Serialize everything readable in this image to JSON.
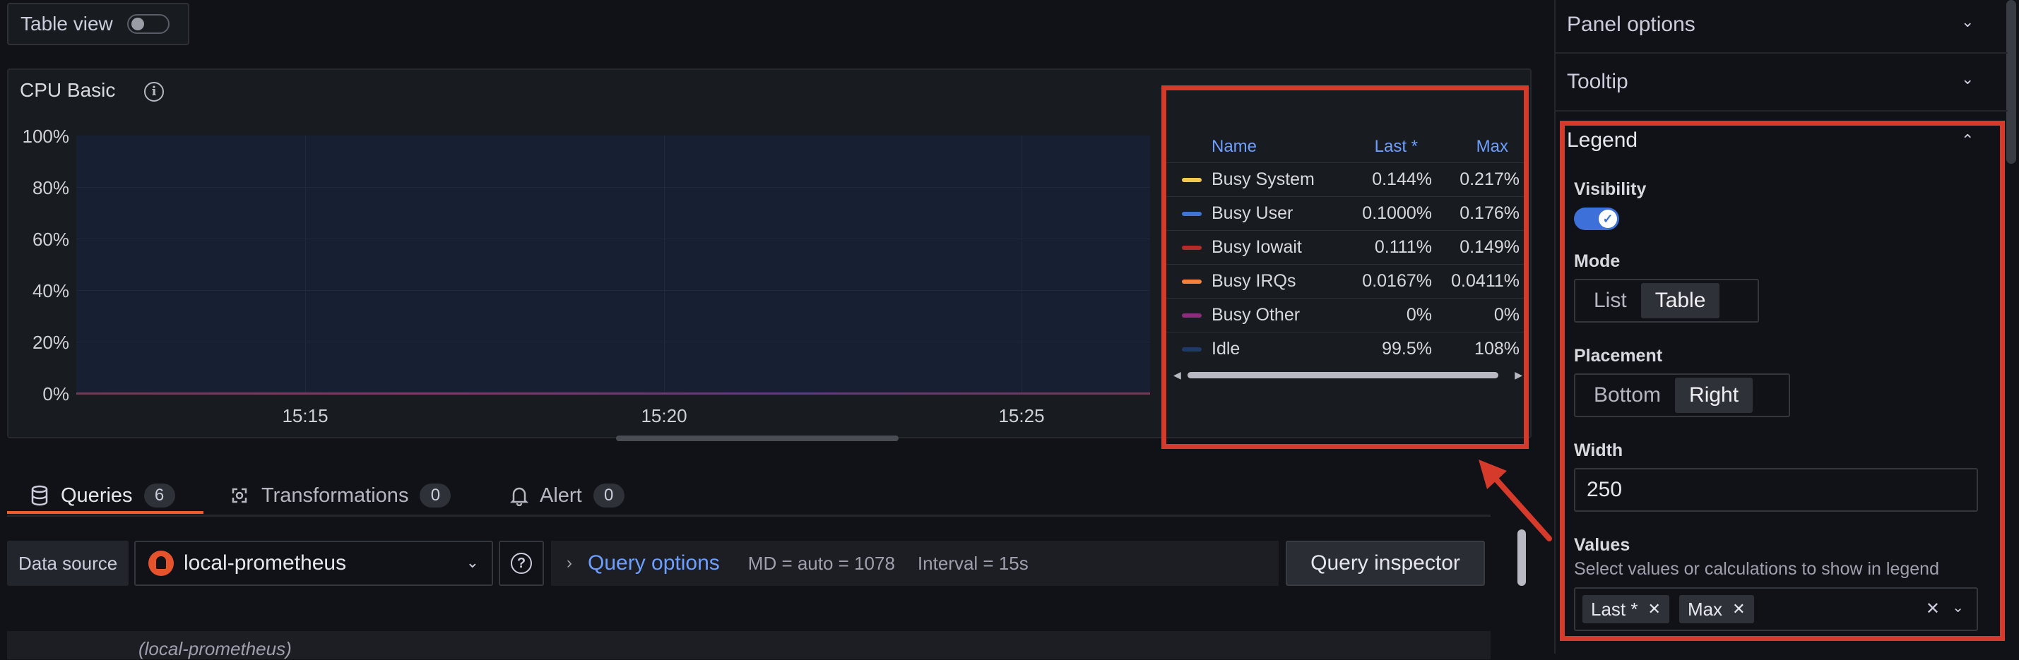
{
  "toolbar": {
    "table_view_label": "Table view"
  },
  "panel": {
    "title": "CPU Basic",
    "y_ticks": [
      "100%",
      "80%",
      "60%",
      "40%",
      "20%",
      "0%"
    ],
    "x_ticks": [
      "15:15",
      "15:20",
      "15:25"
    ]
  },
  "legend_table": {
    "columns": {
      "name": "Name",
      "last": "Last *",
      "max": "Max"
    },
    "rows": [
      {
        "name": "Busy System",
        "last": "0.144%",
        "max": "0.217%",
        "color": "#f2c94c"
      },
      {
        "name": "Busy User",
        "last": "0.1000%",
        "max": "0.176%",
        "color": "#3f73d4"
      },
      {
        "name": "Busy Iowait",
        "last": "0.111%",
        "max": "0.149%",
        "color": "#b32b2b"
      },
      {
        "name": "Busy IRQs",
        "last": "0.0167%",
        "max": "0.0411%",
        "color": "#f5823a"
      },
      {
        "name": "Busy Other",
        "last": "0%",
        "max": "0%",
        "color": "#8b2d7a"
      },
      {
        "name": "Idle",
        "last": "99.5%",
        "max": "108%",
        "color": "#1f3a66"
      }
    ]
  },
  "tabs": [
    {
      "label": "Queries",
      "count": "6"
    },
    {
      "label": "Transformations",
      "count": "0"
    },
    {
      "label": "Alert",
      "count": "0"
    }
  ],
  "query": {
    "data_source_label": "Data source",
    "data_source_value": "local-prometheus",
    "query_options_label": "Query options",
    "md_info": "MD = auto = 1078",
    "interval_info": "Interval = 15s",
    "inspector_label": "Query inspector",
    "row_partial": "(local-prometheus)"
  },
  "options": {
    "panel_options": "Panel options",
    "tooltip": "Tooltip",
    "legend": "Legend",
    "visibility_label": "Visibility",
    "mode_label": "Mode",
    "mode_options": [
      "List",
      "Table"
    ],
    "mode_selected": "Table",
    "placement_label": "Placement",
    "placement_options": [
      "Bottom",
      "Right"
    ],
    "placement_selected": "Right",
    "width_label": "Width",
    "width_value": "250",
    "values_label": "Values",
    "values_description": "Select values or calculations to show in legend",
    "values_selected": [
      "Last *",
      "Max"
    ]
  },
  "colors": {
    "highlight": "#d53a2a",
    "accent": "#6e9fff",
    "active_tab": "#f05a28"
  }
}
